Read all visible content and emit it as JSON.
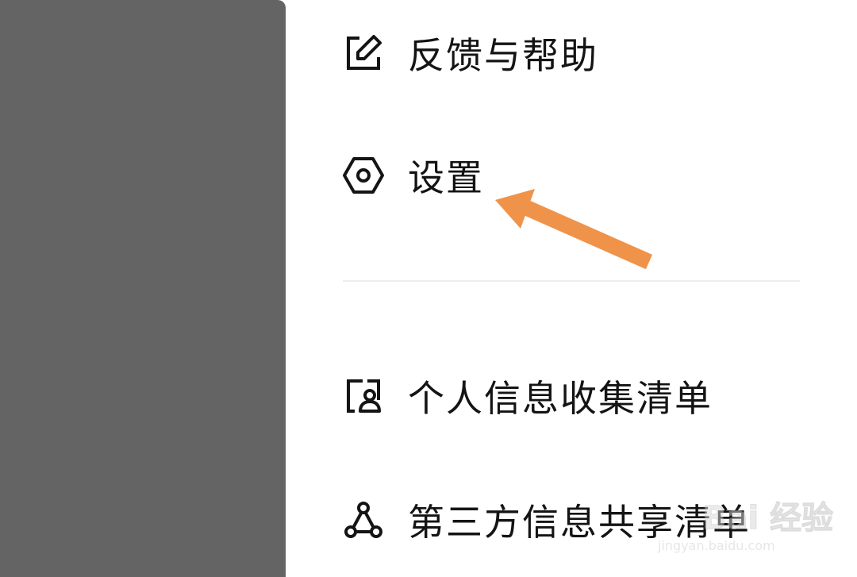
{
  "drawer": {
    "items": [
      {
        "label": "反馈与帮助",
        "icon": "feedback-edit-icon"
      },
      {
        "label": "设置",
        "icon": "settings-hex-icon"
      },
      {
        "label": "个人信息收集清单",
        "icon": "personal-info-icon"
      },
      {
        "label": "第三方信息共享清单",
        "icon": "share-nodes-icon"
      }
    ]
  },
  "annotation": {
    "arrow_color": "#F0934A"
  },
  "watermark": {
    "brand": "Bai 经验",
    "url": "jingyan.baidu.com"
  },
  "colors": {
    "overlay": "#646464",
    "text": "#141414",
    "divider": "#EEEEEE"
  }
}
